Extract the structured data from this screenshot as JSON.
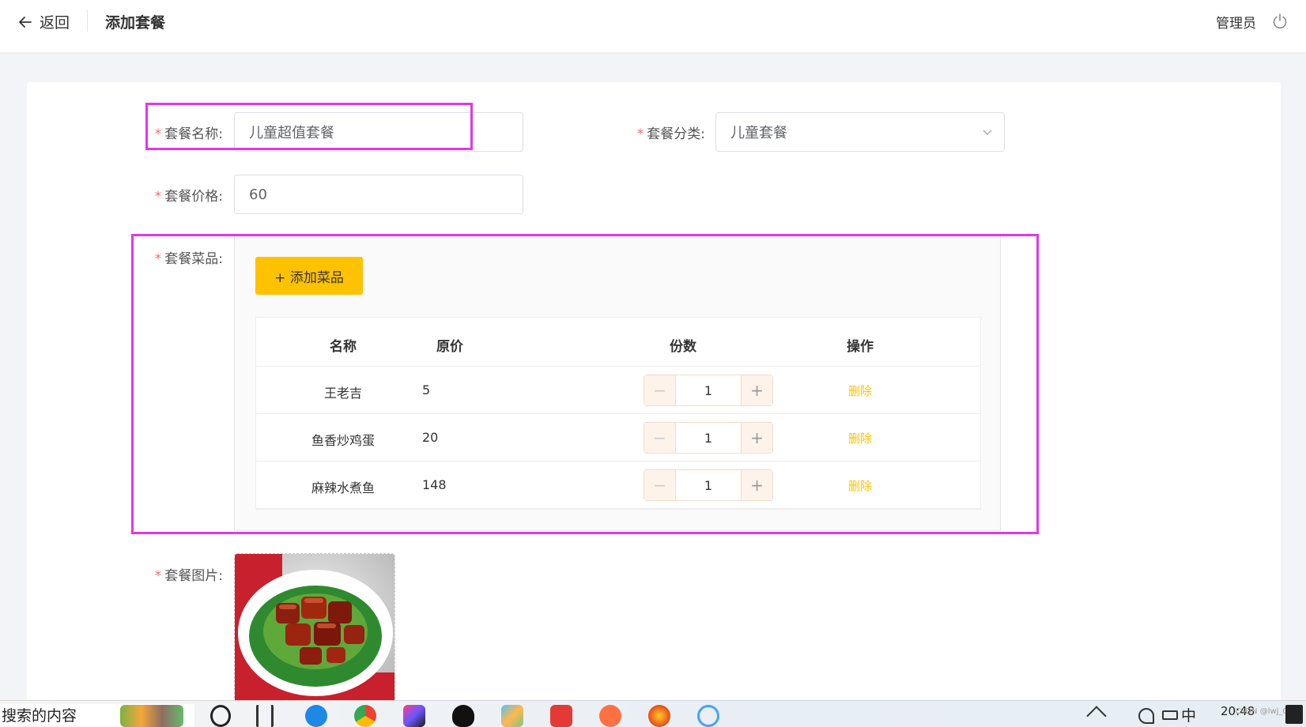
{
  "header": {
    "back_label": "返回",
    "title": "添加套餐",
    "user": "管理员"
  },
  "form": {
    "name": {
      "label": "套餐名称:",
      "value": "儿童超值套餐"
    },
    "category": {
      "label": "套餐分类:",
      "value": "儿童套餐"
    },
    "price": {
      "label": "套餐价格:",
      "value": "60"
    },
    "dishes": {
      "label": "套餐菜品:",
      "add_button": "+ 添加菜品",
      "columns": [
        "名称",
        "原价",
        "份数",
        "操作"
      ],
      "rows": [
        {
          "name": "王老吉",
          "price": "5",
          "qty": "1",
          "action": "删除"
        },
        {
          "name": "鱼香炒鸡蛋",
          "price": "20",
          "qty": "1",
          "action": "删除"
        },
        {
          "name": "麻辣水煮鱼",
          "price": "148",
          "qty": "1",
          "action": "删除"
        }
      ]
    },
    "image": {
      "label": "套餐图片:"
    }
  },
  "taskbar": {
    "search_text": "搜索的内容",
    "ime": "中",
    "time": "20:48",
    "watermark": "CSDN @lwj_07"
  },
  "colors": {
    "accent": "#ffc200",
    "required": "#f56c6c",
    "highlight": "#e535e8"
  }
}
